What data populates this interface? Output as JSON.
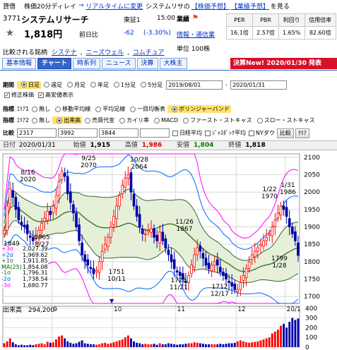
{
  "header": {
    "category": "貸借",
    "delay_note": "株価20分ディレイ",
    "arrow": "→",
    "realtime_link": "リアルタイムに変更",
    "company_short": "システムリサの",
    "forecast_link": "【株価予想】",
    "earnings_link": "【業績予想】",
    "see_more": "を見る"
  },
  "quote": {
    "code": "3771",
    "name": "システムリサーチ",
    "market": "東証1",
    "time": "15:00",
    "price": "1,818円",
    "prev_label": "前日比",
    "change": "-62",
    "change_pct": "(-3.30%)",
    "sector_label": "業績",
    "sector_link": "情報・通信業",
    "unit": "単位 100株"
  },
  "metrics": {
    "headers": [
      "PER",
      "PBR",
      "利回り",
      "信用倍率"
    ],
    "values": [
      "16.1倍",
      "2.57倍",
      "1.65%",
      "82.60倍"
    ]
  },
  "compare": {
    "label": "比較される銘柄",
    "links": [
      "システナ",
      "ニーズウェル",
      "コムチュア"
    ]
  },
  "tabs": [
    "基本情報",
    "チャート",
    "時系列",
    "ニュース",
    "決算",
    "大株主"
  ],
  "active_tab": 1,
  "news_banner": "決算New! 2020/01/30 発表",
  "period": {
    "label": "期間",
    "options": [
      "日足",
      "週足",
      "月足",
      "年足",
      "1分足",
      "5分足"
    ],
    "selected": 0,
    "from": "2019/08/01",
    "to": "2020/01/31"
  },
  "checks": [
    {
      "label": "修正株価",
      "checked": true
    },
    {
      "label": "高安値表示",
      "checked": true
    }
  ],
  "indicator1": {
    "label": "指標",
    "area": "ｴﾘｱ1",
    "options": [
      "無し",
      "移動平均線",
      "平均足線",
      "一目均衡表",
      "ボリンジャーバンド"
    ],
    "selected": 4
  },
  "indicator2": {
    "label": "指標",
    "area": "ｴﾘｱ2",
    "options": [
      "無し",
      "出来高",
      "売買代金",
      "カイリ率",
      "MACD",
      "ファースト・ストキャス",
      "スロー・ストキャス"
    ],
    "selected": 1
  },
  "comparison": {
    "label": "比較",
    "codes": [
      "2317",
      "3992",
      "3844",
      ""
    ],
    "options": [
      "日経平均",
      "ｼﾞｬｽﾀﾞｯｸ平均",
      "NYダウ"
    ],
    "compare_btn": "比較",
    "clear_btn": "ｸﾘｱ"
  },
  "ohlc_bar": {
    "date_label": "日付",
    "date": "2020/01/31",
    "open_label": "始値",
    "open": "1,915",
    "high_label": "高値",
    "high": "1,986",
    "low_label": "安値",
    "low": "1,804",
    "close_label": "終値",
    "close": "1,818"
  },
  "bollinger_legend": [
    {
      "label": "+3σ",
      "value": "2,027.39",
      "color": "#ff00ff"
    },
    {
      "label": "+2σ",
      "value": "1,969.62",
      "color": "#0066ff"
    },
    {
      "label": "+1σ",
      "value": "1,911.85",
      "color": "#336633"
    },
    {
      "label": "MA(25)",
      "value": "1,854.08",
      "color": "#006600"
    },
    {
      "label": "-1σ",
      "value": "1,796.31",
      "color": "#336633"
    },
    {
      "label": "-2σ",
      "value": "1,738.54",
      "color": "#0066ff"
    },
    {
      "label": "-3σ",
      "value": "1,680.77",
      "color": "#ff00ff"
    }
  ],
  "chart_annotations": [
    {
      "date": "8/16",
      "price": "2020"
    },
    {
      "date": "9/25",
      "price": "2070"
    },
    {
      "date": "10/28",
      "price": "2064"
    },
    {
      "date": "1865",
      "price": "8/27"
    },
    {
      "date": "1849",
      "price": ""
    },
    {
      "date": "11/26",
      "price": "1867"
    },
    {
      "date": "1751",
      "price": "10/11"
    },
    {
      "date": "1728",
      "price": "11/21"
    },
    {
      "date": "1712",
      "price": "12/17"
    },
    {
      "date": "1/22",
      "price": "1970"
    },
    {
      "date": "1/31",
      "price": "1986"
    },
    {
      "date": "1799",
      "price": "1/28"
    }
  ],
  "volume_label": "出来高",
  "volume_value": "294,200",
  "chart_data": {
    "type": "candlestick",
    "x_ticks": [
      "9",
      "10",
      "11",
      "12",
      "20/1"
    ],
    "y_ticks": [
      1700,
      1750,
      1800,
      1850,
      1900,
      1950,
      2000,
      2050,
      2100
    ],
    "ylim": [
      1680,
      2110
    ],
    "volume_ticks": [
      0,
      100,
      200,
      300,
      400
    ],
    "volume_ylim": [
      0,
      420
    ],
    "close": [
      1890,
      1960,
      2010,
      1985,
      1950,
      1920,
      1905,
      1900,
      1880,
      1870,
      1860,
      1875,
      1890,
      1910,
      1925,
      1945,
      1935,
      1960,
      1990,
      2030,
      2060,
      2045,
      1995,
      1970,
      1940,
      1900,
      1860,
      1820,
      1800,
      1790,
      1780,
      1765,
      1775,
      1800,
      1830,
      1850,
      1870,
      1900,
      1930,
      1960,
      1990,
      2020,
      2040,
      2050,
      2000,
      1960,
      1930,
      1900,
      1880,
      1880,
      1890,
      1895,
      1870,
      1860,
      1885,
      1860,
      1840,
      1820,
      1800,
      1780,
      1770,
      1760,
      1750,
      1740,
      1760,
      1790,
      1820,
      1840,
      1830,
      1810,
      1790,
      1780,
      1790,
      1800,
      1790,
      1770,
      1760,
      1750,
      1740,
      1730,
      1720,
      1720,
      1740,
      1760,
      1780,
      1800,
      1820,
      1830,
      1840,
      1850,
      1860,
      1870,
      1880,
      1900,
      1920,
      1940,
      1960,
      1950,
      1930,
      1900,
      1880,
      1860,
      1818
    ],
    "volume": [
      40,
      60,
      90,
      50,
      30,
      20,
      25,
      20,
      20,
      25,
      20,
      30,
      35,
      40,
      30,
      55,
      45,
      50,
      80,
      110,
      120,
      90,
      60,
      45,
      35,
      40,
      55,
      70,
      40,
      35,
      30,
      30,
      25,
      30,
      40,
      45,
      35,
      40,
      50,
      60,
      70,
      80,
      100,
      120,
      90,
      60,
      45,
      40,
      30,
      35,
      30,
      30,
      35,
      25,
      40,
      30,
      30,
      40,
      35,
      30,
      25,
      30,
      30,
      35,
      40,
      40,
      50,
      45,
      40,
      35,
      30,
      30,
      30,
      30,
      30,
      35,
      30,
      35,
      40,
      40,
      45,
      60,
      70,
      60,
      50,
      45,
      50,
      55,
      60,
      70,
      80,
      90,
      100,
      140,
      160,
      180,
      220,
      240,
      200,
      260,
      300,
      280,
      294
    ]
  },
  "colors": {
    "accent": "#3366cc",
    "up": "#ff0000",
    "down": "#0000aa",
    "ma": "#4d7a3a",
    "band1": "#336633",
    "band2": "#0066ff",
    "band3": "#ff00ff",
    "band_fill": "#e6f0d9"
  }
}
